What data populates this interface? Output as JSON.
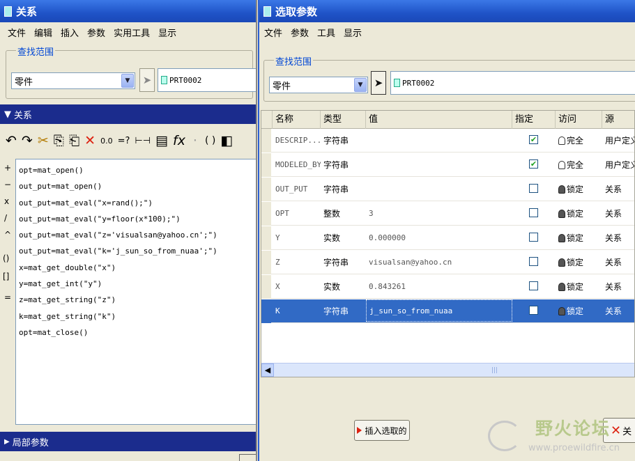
{
  "left_window": {
    "title": "关系",
    "menu": [
      "文件",
      "编辑",
      "插入",
      "参数",
      "实用工具",
      "显示"
    ],
    "scope_legend": "查找范围",
    "scope_value": "零件",
    "model_name": "PRT0002",
    "section_title": "关系",
    "section_chevron": "▼",
    "toolbar_glyphs": [
      "↶",
      "↷",
      "✂",
      "⎘",
      "⎗",
      "✕",
      "0.0",
      "=?",
      "⊢⊣",
      "▤",
      "fx",
      "·",
      "( )",
      "◧"
    ],
    "side_ops": [
      "+",
      "−",
      "x",
      "/",
      "^",
      "()",
      "[]",
      "="
    ],
    "relations": [
      "opt=mat_open()",
      "out_put=mat_open()",
      "out_put=mat_eval(\"x=rand();\")",
      "out_put=mat_eval(\"y=floor(x*100);\")",
      "out_put=mat_eval(\"z='visualsan@yahoo.cn';\")",
      "out_put=mat_eval(\"k='j_sun_so_from_nuaa';\")",
      "x=mat_get_double(\"x\")",
      "y=mat_get_int(\"y\")",
      "z=mat_get_string(\"z\")",
      "k=mat_get_string(\"k\")",
      "opt=mat_close()"
    ],
    "local_params_title": "局部参数",
    "local_params_chevron": "▶"
  },
  "right_window": {
    "title": "选取参数",
    "menu": [
      "文件",
      "参数",
      "工具",
      "显示"
    ],
    "scope_legend": "查找范围",
    "scope_value": "零件",
    "model_name": "PRT0002",
    "columns": [
      "名称",
      "类型",
      "值",
      "指定",
      "访问",
      "源"
    ],
    "rows": [
      {
        "name": "DESCRIP...",
        "type": "字符串",
        "value": "",
        "designated": true,
        "access": "完全",
        "access_locked": false,
        "source": "用户定义"
      },
      {
        "name": "MODELED_BY",
        "type": "字符串",
        "value": "",
        "designated": true,
        "access": "完全",
        "access_locked": false,
        "source": "用户定义"
      },
      {
        "name": "OUT_PUT",
        "type": "字符串",
        "value": "",
        "designated": false,
        "access": "锁定",
        "access_locked": true,
        "source": "关系"
      },
      {
        "name": "OPT",
        "type": "整数",
        "value": "3",
        "designated": false,
        "access": "锁定",
        "access_locked": true,
        "source": "关系"
      },
      {
        "name": "Y",
        "type": "实数",
        "value": "0.000000",
        "designated": false,
        "access": "锁定",
        "access_locked": true,
        "source": "关系"
      },
      {
        "name": "Z",
        "type": "字符串",
        "value": "visualsan@yahoo.cn",
        "designated": false,
        "access": "锁定",
        "access_locked": true,
        "source": "关系"
      },
      {
        "name": "X",
        "type": "实数",
        "value": "0.843261",
        "designated": false,
        "access": "锁定",
        "access_locked": true,
        "source": "关系"
      },
      {
        "name": "K",
        "type": "字符串",
        "value": "j_sun_so_from_nuaa",
        "designated": false,
        "access": "锁定",
        "access_locked": true,
        "source": "关系",
        "selected": true
      }
    ],
    "insert_button": "插入选取的",
    "close_button": "关"
  },
  "watermark": {
    "title": "野火论坛",
    "url": "www.proewildfire.cn"
  },
  "colors": {
    "titlebar": "#1f53c7",
    "section_bar": "#1b2c8d",
    "selection": "#316ac5",
    "window_bg": "#ece9d8"
  }
}
